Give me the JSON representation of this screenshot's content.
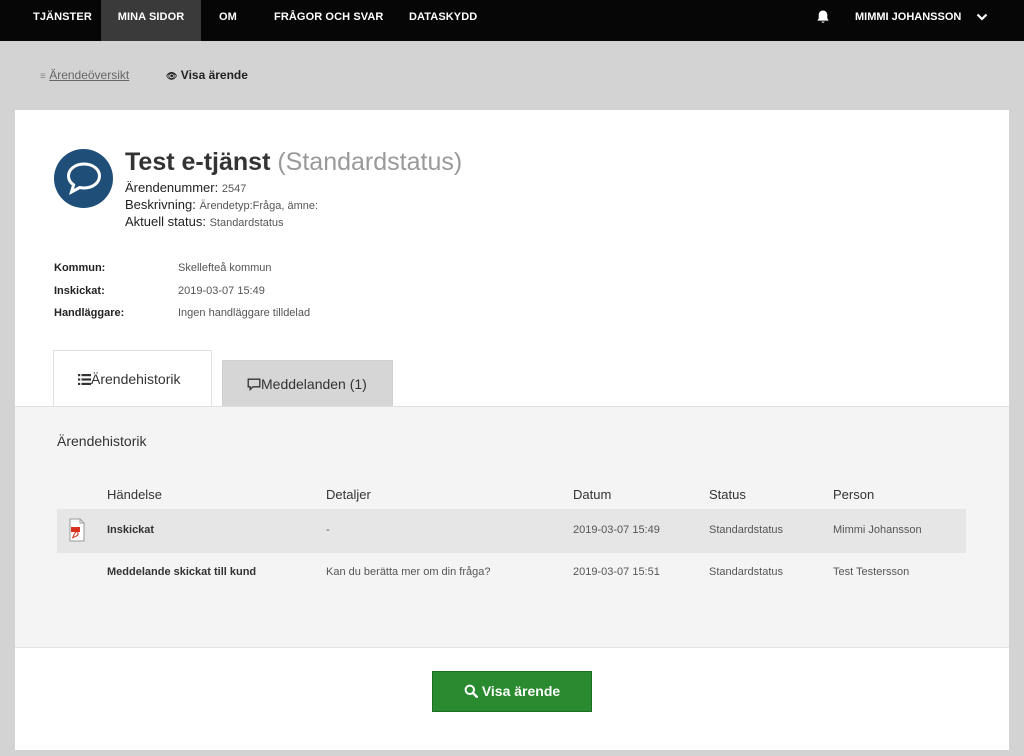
{
  "nav": {
    "items": [
      "TJÄNSTER",
      "MINA SIDOR",
      "OM",
      "FRÅGOR OCH SVAR",
      "DATASKYDD"
    ],
    "user": "MIMMI JOHANSSON"
  },
  "breadcrumb": {
    "overview": "Ärendeöversikt",
    "current": "Visa ärende"
  },
  "case": {
    "name": "Test e-tjänst",
    "status_paren": "(Standardstatus)",
    "number_label": "Ärendenummer:",
    "number": "2547",
    "desc_label": "Beskrivning:",
    "desc": "Ärendetyp:Fråga, ämne:",
    "status_label": "Aktuell status:",
    "status": "Standardstatus"
  },
  "info": {
    "kommun_label": "Kommun:",
    "kommun": "Skellefteå kommun",
    "sent_label": "Inskickat:",
    "sent": "2019-03-07 15:49",
    "handler_label": "Handläggare:",
    "handler": "Ingen handläggare tilldelad"
  },
  "tabs": {
    "history": "Ärendehistorik",
    "messages": "Meddelanden (1)"
  },
  "history": {
    "title": "Ärendehistorik",
    "columns": [
      "Händelse",
      "Detaljer",
      "Datum",
      "Status",
      "Person"
    ],
    "rows": [
      {
        "event": "Inskickat",
        "details": "-",
        "date": "2019-03-07 15:49",
        "status": "Standardstatus",
        "person": "Mimmi Johansson"
      },
      {
        "event": "Meddelande skickat till kund",
        "details": "Kan du berätta mer om din fråga?",
        "date": "2019-03-07 15:51",
        "status": "Standardstatus",
        "person": "Test Testersson"
      }
    ]
  },
  "action": {
    "view_case": "Visa ärende"
  },
  "colors": {
    "nav_bg": "#060606",
    "avatar": "#1f4e79",
    "button": "#2a8a2f"
  }
}
